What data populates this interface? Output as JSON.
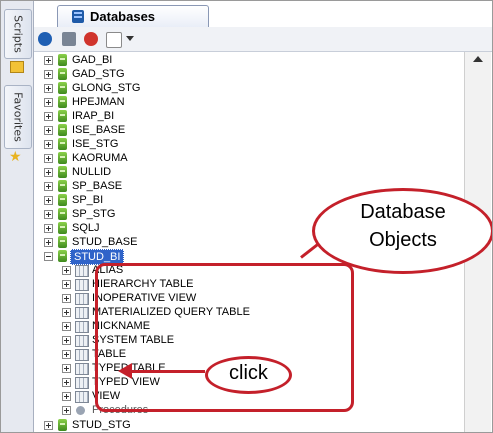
{
  "side_tabs": [
    {
      "label": "Scripts"
    },
    {
      "label": "Favorites"
    }
  ],
  "tab": {
    "label": "Databases"
  },
  "toolbar": {
    "icons": [
      "connect-icon",
      "disconnect-icon",
      "stop-icon",
      "filter-icon",
      "dropdown-icon"
    ]
  },
  "tree": {
    "databases": [
      {
        "label": "GAD_BI"
      },
      {
        "label": "GAD_STG"
      },
      {
        "label": "GLONG_STG"
      },
      {
        "label": "HPEJMAN"
      },
      {
        "label": "IRAP_BI"
      },
      {
        "label": "ISE_BASE"
      },
      {
        "label": "ISE_STG"
      },
      {
        "label": "KAORUMA"
      },
      {
        "label": "NULLID"
      },
      {
        "label": "SP_BASE"
      },
      {
        "label": "SP_BI"
      },
      {
        "label": "SP_STG"
      },
      {
        "label": "SQLJ"
      },
      {
        "label": "STUD_BASE"
      }
    ],
    "selected": {
      "label": "STUD_BI"
    },
    "objects": [
      {
        "label": "ALIAS"
      },
      {
        "label": "HIERARCHY TABLE"
      },
      {
        "label": "INOPERATIVE VIEW"
      },
      {
        "label": "MATERIALIZED QUERY TABLE"
      },
      {
        "label": "NICKNAME"
      },
      {
        "label": "SYSTEM TABLE"
      },
      {
        "label": "TABLE"
      },
      {
        "label": "TYPED TABLE"
      },
      {
        "label": "TYPED VIEW"
      },
      {
        "label": "VIEW"
      }
    ],
    "procedures": {
      "label": "Procedures"
    },
    "last": {
      "label": "STUD_STG"
    }
  },
  "annotation": {
    "callout_line1": "Database",
    "callout_line2": "Objects",
    "click_label": "click",
    "color": "#c4202a"
  }
}
